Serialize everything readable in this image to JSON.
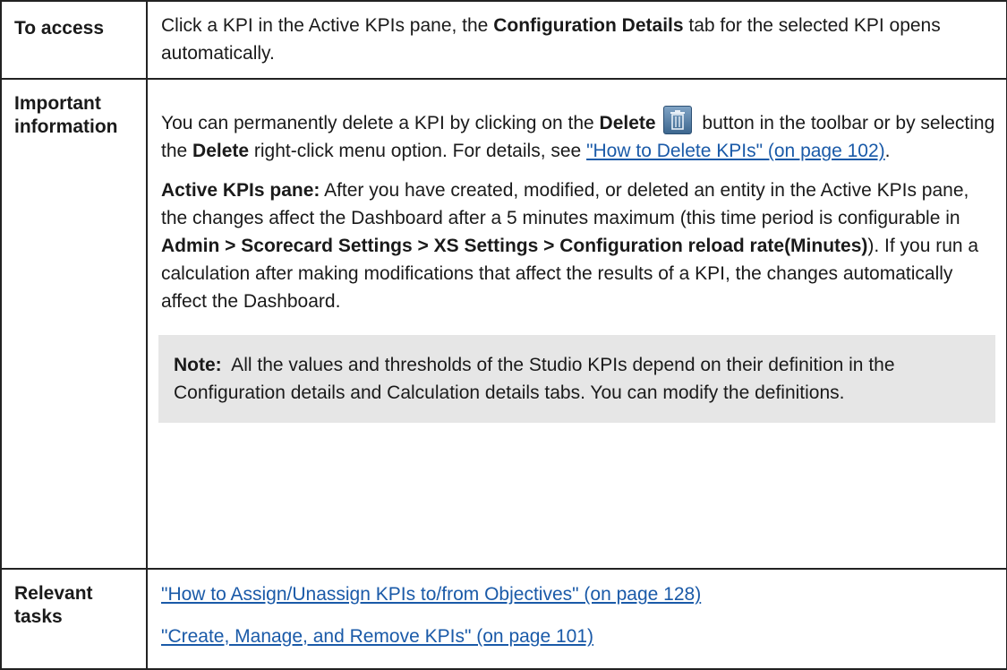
{
  "access": {
    "label": "To access",
    "text_1": "Click a KPI in the Active KPIs pane, the ",
    "bold_1": "Configuration Details",
    "text_2": " tab for the selected KPI opens automatically."
  },
  "important": {
    "label_line1": "Important",
    "label_line2": "information",
    "p1": {
      "text_1": "You can permanently delete a KPI by clicking on the ",
      "bold_1": "Delete",
      "icon": "trash-icon",
      "text_2": " button in the toolbar or by selecting the ",
      "bold_2": "Delete",
      "text_3": " right-click menu option. For details, see ",
      "link_1": "\"How to Delete KPIs\" (on page 102)",
      "text_4": "."
    },
    "p2": {
      "bold_1": "Active KPIs pane:",
      "text_1": " After you have created, modified, or deleted an entity in the Active KPIs pane, the changes affect the Dashboard after a 5 minutes maximum (this time period is configurable in ",
      "bold_2": "Admin > Scorecard Settings > XS Settings > Configuration reload rate(Minutes)",
      "text_2": "). If you run a calculation after making modifications that affect the results of a KPI, the changes automatically affect the Dashboard."
    },
    "note": {
      "bold_1": "Note:",
      "text_1": "  All the values and thresholds of the Studio KPIs depend on their definition in the Configuration details and Calculation details tabs. You can modify the definitions."
    }
  },
  "tasks": {
    "label_line1": "Relevant",
    "label_line2": "tasks",
    "links": [
      "\"How to Assign/Unassign KPIs to/from Objectives\" (on page 128)",
      "\"Create, Manage, and Remove KPIs\" (on page 101)"
    ]
  },
  "colors": {
    "link": "#1a5aa8",
    "note_background": "#e6e6e6",
    "border": "#222222"
  }
}
